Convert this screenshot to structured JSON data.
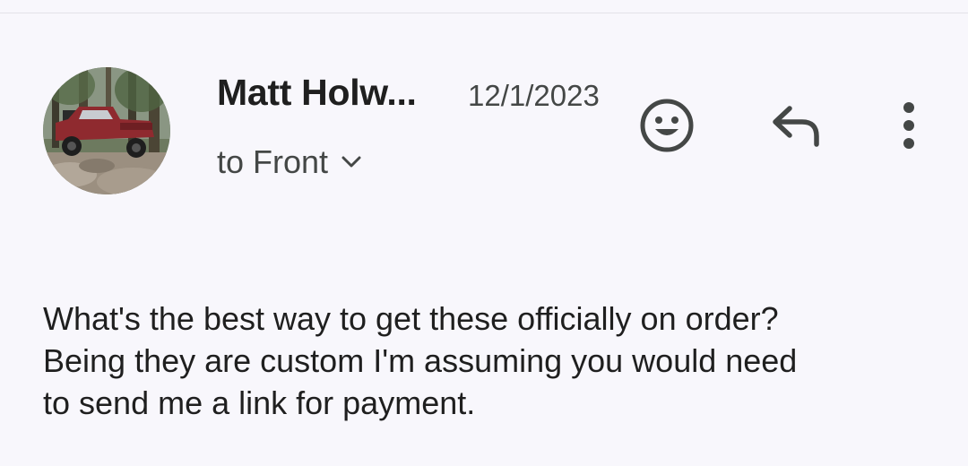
{
  "message": {
    "sender_name": "Matt Holw...",
    "date": "12/1/2023",
    "recipient_label": "to Front",
    "body_lines": [
      "What's the best way to get these officially on order?",
      "Being they are custom I'm assuming you would need",
      "to send me a link for payment."
    ]
  },
  "icons": {
    "avatar": "avatar-photo-red-truck",
    "recipient_toggle": "chevron-down-icon",
    "react": "smiley-icon",
    "reply": "reply-icon",
    "more": "more-vert-icon"
  },
  "colors": {
    "background": "#f8f7fc",
    "text_primary": "#1f1f1f",
    "text_secondary": "#444746"
  }
}
